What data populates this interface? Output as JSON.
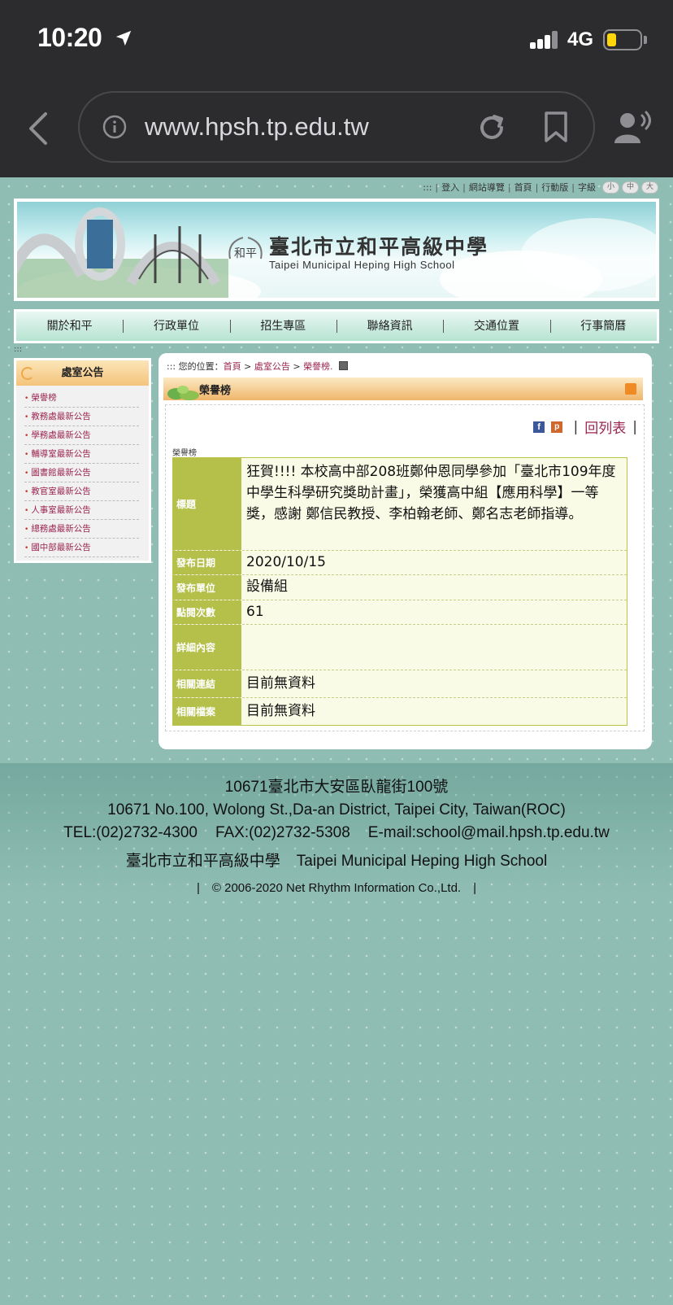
{
  "status_bar": {
    "time": "10:20",
    "network": "4G"
  },
  "browser": {
    "url": "www.hpsh.tp.edu.tw"
  },
  "top_links": {
    "marker": ":::",
    "items": [
      "登入",
      "網站導覽",
      "首頁",
      "行動版",
      "字級"
    ],
    "font_sizes": [
      "小",
      "中",
      "大"
    ]
  },
  "banner": {
    "school_name_zh": "臺北市立和平高級中學",
    "school_name_en": "Taipei Municipal Heping High School",
    "logo_text": "和平"
  },
  "main_nav": [
    "關於和平",
    "行政單位",
    "招生專區",
    "聯絡資訊",
    "交通位置",
    "行事簡曆"
  ],
  "sidebar": {
    "title": "處室公告",
    "items": [
      "榮譽榜",
      "教務處最新公告",
      "學務處最新公告",
      "輔導室最新公告",
      "圖書館最新公告",
      "教官室最新公告",
      "人事室最新公告",
      "總務處最新公告",
      "國中部最新公告"
    ]
  },
  "breadcrumb": {
    "prefix": "::: 您的位置：",
    "home": "首頁",
    "sep": ">",
    "section": "處室公告",
    "current": "榮譽榜."
  },
  "section": {
    "title": "榮譽榜"
  },
  "share": {
    "back_to_list": "回列表",
    "fb": "f",
    "plurk": "p"
  },
  "detail": {
    "caption": "榮譽榜",
    "rows": [
      {
        "label": "標題",
        "value": "狂賀!!!! 本校高中部208班鄭仲恩同學參加「臺北市109年度中學生科學研究獎助計畫」，榮獲高中組【應用科學】一等獎，感謝 鄭信民教授、李柏翰老師、鄭名志老師指導。"
      },
      {
        "label": "發布日期",
        "value": "2020/10/15"
      },
      {
        "label": "發布單位",
        "value": "設備組"
      },
      {
        "label": "點閱次數",
        "value": "61"
      },
      {
        "label": "詳細內容",
        "value": ""
      },
      {
        "label": "相關連結",
        "value": "目前無資料"
      },
      {
        "label": "相關檔案",
        "value": "目前無資料"
      }
    ]
  },
  "footer": {
    "address_zh": "10671臺北市大安區臥龍街100號",
    "address_en": "10671 No.100, Wolong St.,Da-an District, Taipei City, Taiwan(ROC)",
    "tel": "TEL:(02)2732-4300",
    "fax": "FAX:(02)2732-5308",
    "email": "E-mail:school@mail.hpsh.tp.edu.tw",
    "school_zh": "臺北市立和平高級中學",
    "school_en": "Taipei Municipal Heping High School",
    "copyright": "|　© 2006-2020  Net Rhythm Information Co.,Ltd.　|"
  },
  "colors": {
    "page_bg": "#8fbdb3",
    "accent_link": "#9b2550",
    "label_green": "#b4c04a",
    "chrome_dark": "#2c2c2e"
  }
}
